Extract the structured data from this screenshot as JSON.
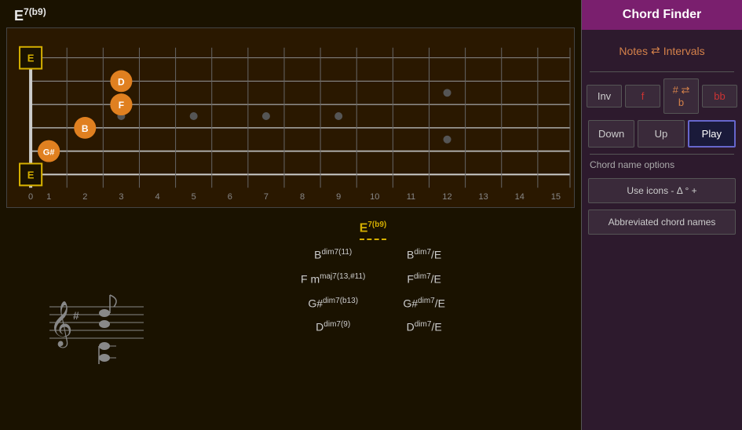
{
  "header": {
    "chord_title": "E",
    "chord_title_sup": "7(b9)"
  },
  "right_panel": {
    "chord_finder_label": "Chord Finder",
    "notes_intervals_label": "Notes",
    "notes_intervals_icon": "⇄",
    "notes_intervals_suffix": "Intervals",
    "controls": {
      "inv_label": "Inv",
      "f_label": "f",
      "sharp_eq_b_label": "# ⇄ b",
      "bb_label": "bb"
    },
    "nav": {
      "down_label": "Down",
      "up_label": "Up",
      "play_label": "Play"
    },
    "chord_name_options_label": "Chord name options",
    "use_icons_btn": "Use icons - Δ ° +",
    "abbreviated_btn": "Abbreviated chord names"
  },
  "chord_list": {
    "title": "E",
    "title_sup": "7(b9)",
    "left_column": [
      {
        "name": "B",
        "pre": "",
        "sup": "dim7(11)",
        "sub": ""
      },
      {
        "name": "Fm",
        "pre": "F",
        "sub": "m",
        "sup": "maj7(13,#11)"
      },
      {
        "name": "G#dim7b13",
        "pre": "G#",
        "sub": "",
        "sup": "dim7(b13)"
      },
      {
        "name": "Ddim79",
        "pre": "D",
        "sub": "",
        "sup": "dim7(9)"
      }
    ],
    "right_column": [
      {
        "name": "Bdim7/E",
        "pre": "B",
        "sub": "",
        "sup": "dim7",
        "slash": "/E"
      },
      {
        "name": "Fdim7/E",
        "pre": "F",
        "sub": "",
        "sup": "dim7",
        "slash": "/E"
      },
      {
        "name": "G#dim7/E",
        "pre": "G#",
        "sub": "",
        "sup": "dim7",
        "slash": "/E"
      },
      {
        "name": "Ddim7/E",
        "pre": "D",
        "sub": "",
        "sup": "dim7",
        "slash": "/E"
      }
    ]
  },
  "fretboard": {
    "notes": [
      {
        "label": "E",
        "string": 5,
        "fret": 0,
        "type": "square"
      },
      {
        "label": "G#",
        "string": 4,
        "fret": 1,
        "type": "circle"
      },
      {
        "label": "D",
        "string": 3,
        "fret": 3,
        "type": "circle"
      },
      {
        "label": "F",
        "string": 2,
        "fret": 3,
        "type": "circle"
      },
      {
        "label": "B",
        "string": 1,
        "fret": 2,
        "type": "circle"
      },
      {
        "label": "E",
        "string": 0,
        "fret": 0,
        "type": "square"
      }
    ],
    "fret_numbers": [
      0,
      1,
      2,
      3,
      4,
      5,
      6,
      7,
      8,
      9,
      10,
      11,
      12,
      13,
      14,
      15
    ]
  }
}
